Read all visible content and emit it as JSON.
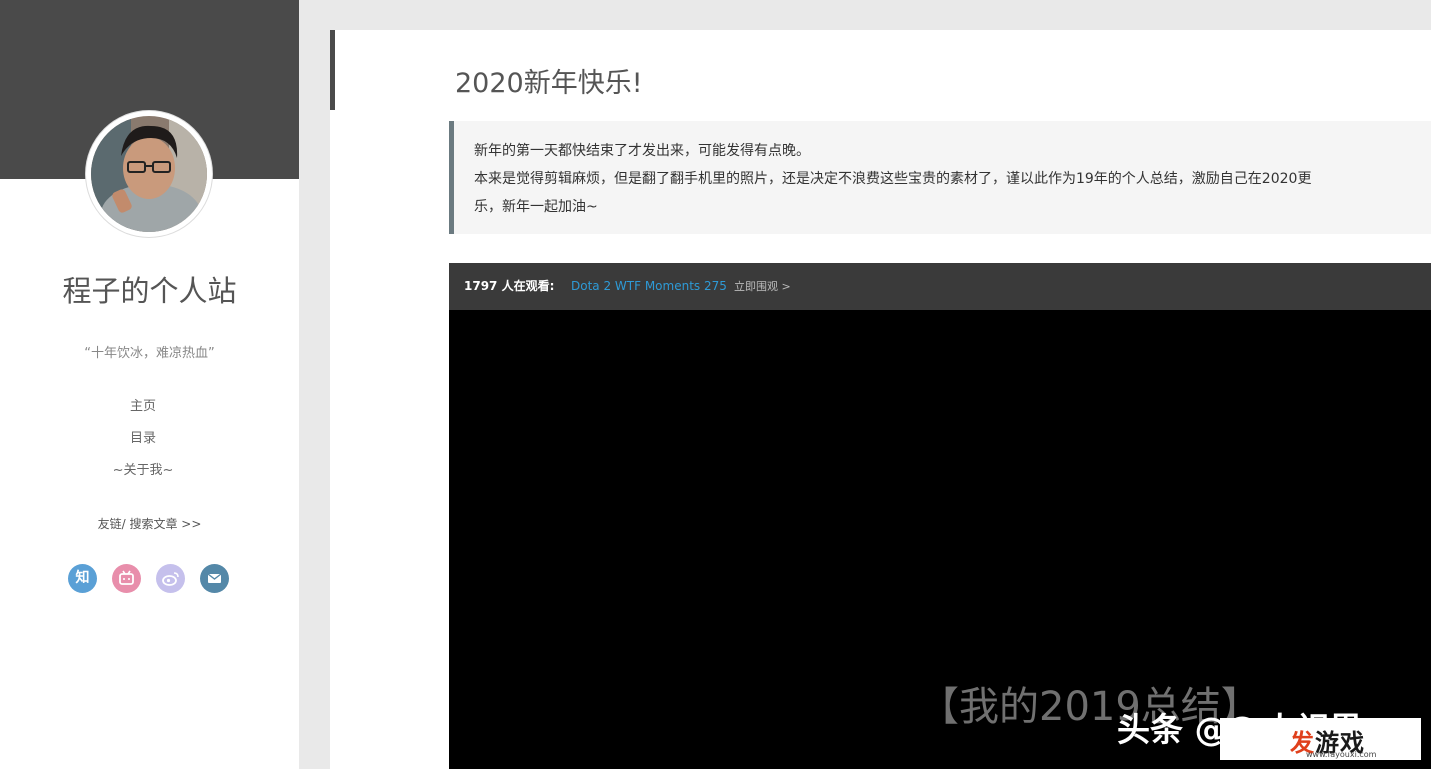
{
  "sidebar": {
    "site_title": "程子的个人站",
    "motto": "“十年饮冰，难凉热血”",
    "nav": [
      {
        "label": "主页"
      },
      {
        "label": "目录"
      },
      {
        "label": "~关于我~"
      }
    ],
    "friend_links": "友链/ 搜索文章 >>",
    "social": [
      {
        "icon": "zhihu-icon",
        "glyph": "知",
        "color": "#5aa0d6"
      },
      {
        "icon": "bilibili-icon",
        "glyph": "",
        "color": "#e88eab"
      },
      {
        "icon": "weibo-icon",
        "glyph": "",
        "color": "#c5c0ec"
      },
      {
        "icon": "mail-icon",
        "glyph": "",
        "color": "#5488a8"
      }
    ]
  },
  "post": {
    "title": "2020新年快乐!",
    "quote_lines": [
      "新年的第一天都快结束了才发出来，可能发得有点晚。",
      "本来是觉得剪辑麻烦，但是翻了翻手机里的照片，还是决定不浪费这些宝贵的素材了，谨以此作为19年的个人总结，激励自己在2020更",
      "乐，新年一起加油~"
    ]
  },
  "player": {
    "viewers": "1797 人在观看:",
    "stream_title": "Dota 2 WTF Moments 275",
    "watch_now": "立即围观 >",
    "subtitle": "【我的2019总结】",
    "source_mark": "头条 @C   大视界"
  },
  "watermark": {
    "brand_a": "发",
    "brand_b": "游戏",
    "domain": "www.fayouxi.com"
  },
  "colors": {
    "sidebar_banner": "#4a4a4a",
    "link_blue": "#2e9ad6",
    "quote_border": "#6b7a80"
  }
}
